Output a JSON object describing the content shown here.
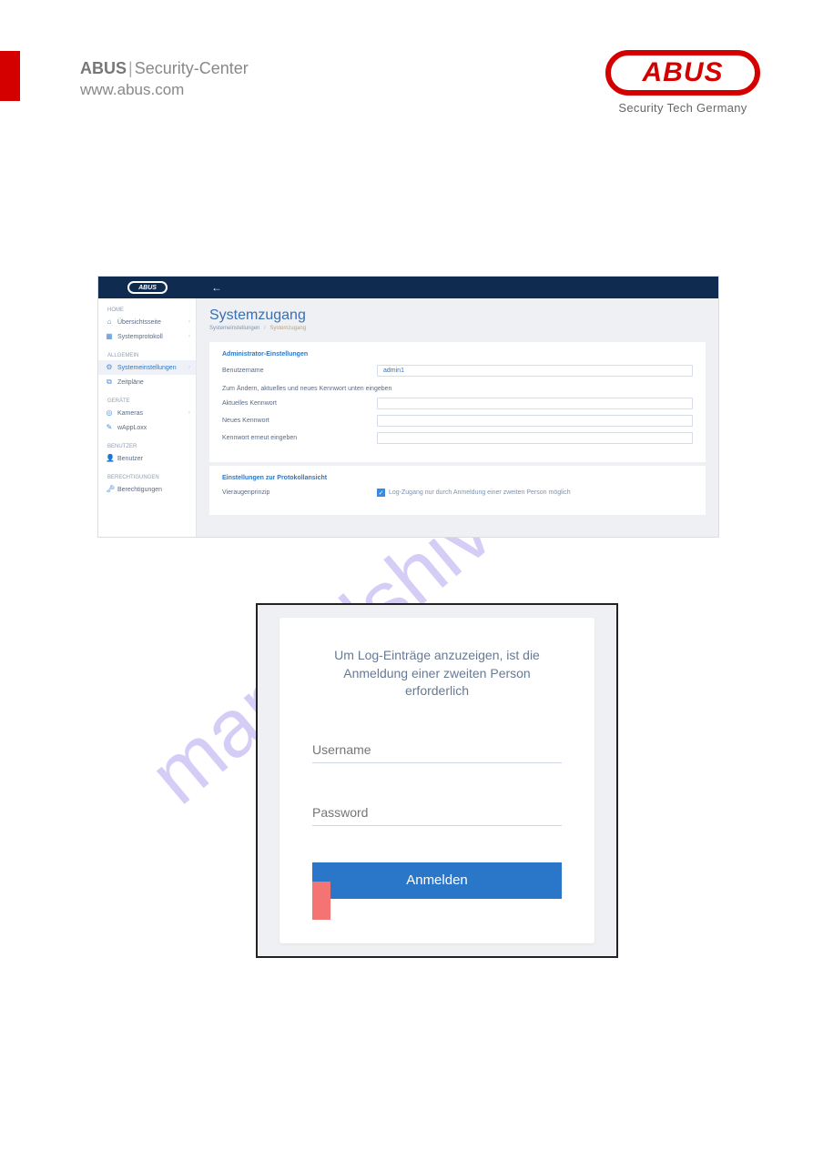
{
  "header": {
    "brand": "ABUS",
    "division": "Security-Center",
    "url": "www.abus.com"
  },
  "logo": {
    "text": "ABUS",
    "tagline": "Security Tech Germany"
  },
  "watermark": "manualshive.com",
  "shot1": {
    "logo": "ABUS",
    "sidebar": {
      "groups": [
        {
          "title": "HOME",
          "items": [
            {
              "icon": "⌂",
              "label": "Übersichtsseite",
              "arr": true
            },
            {
              "icon": "▦",
              "label": "Systemprotokoll",
              "arr": true
            }
          ]
        },
        {
          "title": "ALLGEMEIN",
          "items": [
            {
              "icon": "⚙",
              "label": "Systemeinstellungen",
              "arr": true,
              "active": true
            },
            {
              "icon": "⧉",
              "label": "Zeitpläne"
            }
          ]
        },
        {
          "title": "GERÄTE",
          "items": [
            {
              "icon": "◎",
              "label": "Kameras",
              "arr": true
            },
            {
              "icon": "✎",
              "label": "wAppLoxx"
            }
          ]
        },
        {
          "title": "BENUTZER",
          "items": [
            {
              "icon": "👤",
              "label": "Benutzer"
            }
          ]
        },
        {
          "title": "BERECHTIGUNGEN",
          "items": [
            {
              "icon": "🗝",
              "label": "Berechtigungen"
            }
          ]
        }
      ]
    },
    "page": {
      "title": "Systemzugang",
      "crumb1": "Systemeinstellungen",
      "crumb2": "Systemzugang"
    },
    "admin": {
      "heading": "Administrator-Einstellungen",
      "username_label": "Benutzername",
      "username_value": "admin1",
      "change_note": "Zum Ändern, aktuelles und neues Kennwort unten eingeben",
      "current_pw": "Aktuelles Kennwort",
      "new_pw": "Neues Kennwort",
      "repeat_pw": "Kennwort erneut eingeben"
    },
    "proto": {
      "heading": "Einstellungen zur Protokollansicht",
      "principle": "Vieraugenprinzip",
      "checkbox_text": "Log-Zugang nur durch Anmeldung einer zweiten Person möglich"
    }
  },
  "shot2": {
    "message": "Um Log-Einträge anzuzeigen, ist die Anmeldung einer zweiten Person erforderlich",
    "username_ph": "Username",
    "password_ph": "Password",
    "login_btn": "Anmelden"
  }
}
